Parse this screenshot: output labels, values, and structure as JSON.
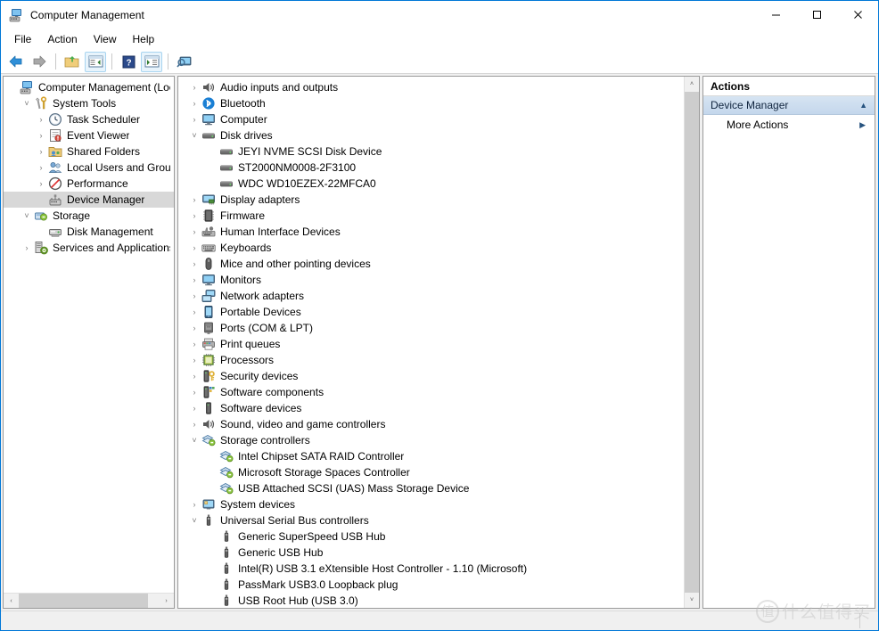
{
  "window": {
    "title": "Computer Management",
    "icon": "computer-management-icon",
    "minimize": "—",
    "maximize": "☐",
    "close": "✕"
  },
  "menu": [
    {
      "label": "File"
    },
    {
      "label": "Action"
    },
    {
      "label": "View"
    },
    {
      "label": "Help"
    }
  ],
  "toolbar": [
    {
      "name": "back-button",
      "icon": "back-arrow-icon",
      "framed": false
    },
    {
      "name": "forward-button",
      "icon": "forward-arrow-icon",
      "framed": false
    },
    {
      "name": "separator-1",
      "icon": "separator",
      "framed": false
    },
    {
      "name": "up-folder-button",
      "icon": "folder-up-icon",
      "framed": false
    },
    {
      "name": "show-hide-console-tree-button",
      "icon": "console-tree-icon",
      "framed": true
    },
    {
      "name": "separator-2",
      "icon": "separator",
      "framed": false
    },
    {
      "name": "help-button",
      "icon": "question-mark-icon",
      "framed": false
    },
    {
      "name": "show-hide-action-pane-button",
      "icon": "action-pane-icon",
      "framed": true
    },
    {
      "name": "separator-3",
      "icon": "separator",
      "framed": false
    },
    {
      "name": "scan-hardware-changes-button",
      "icon": "monitor-scan-icon",
      "framed": false
    }
  ],
  "console_tree": {
    "items": [
      {
        "label": "Computer Management (Local",
        "indent": 0,
        "state": "none",
        "icon": "computer-management-icon",
        "selected": false
      },
      {
        "label": "System Tools",
        "indent": 1,
        "state": "expanded",
        "icon": "system-tools-icon",
        "selected": false
      },
      {
        "label": "Task Scheduler",
        "indent": 2,
        "state": "collapsed",
        "icon": "clock-icon",
        "selected": false
      },
      {
        "label": "Event Viewer",
        "indent": 2,
        "state": "collapsed",
        "icon": "event-viewer-icon",
        "selected": false
      },
      {
        "label": "Shared Folders",
        "indent": 2,
        "state": "collapsed",
        "icon": "shared-folders-icon",
        "selected": false
      },
      {
        "label": "Local Users and Groups",
        "indent": 2,
        "state": "collapsed",
        "icon": "users-icon",
        "selected": false
      },
      {
        "label": "Performance",
        "indent": 2,
        "state": "collapsed",
        "icon": "performance-icon",
        "selected": false
      },
      {
        "label": "Device Manager",
        "indent": 2,
        "state": "none",
        "icon": "device-manager-icon",
        "selected": true
      },
      {
        "label": "Storage",
        "indent": 1,
        "state": "expanded",
        "icon": "storage-icon",
        "selected": false
      },
      {
        "label": "Disk Management",
        "indent": 2,
        "state": "none",
        "icon": "disk-management-icon",
        "selected": false
      },
      {
        "label": "Services and Applications",
        "indent": 1,
        "state": "collapsed",
        "icon": "services-icon",
        "selected": false
      }
    ],
    "hscroll": {
      "left_arrow": "‹",
      "right_arrow": "›"
    }
  },
  "device_tree": {
    "items": [
      {
        "label": "Audio inputs and outputs",
        "indent": 0,
        "state": "collapsed",
        "icon": "speaker-icon"
      },
      {
        "label": "Bluetooth",
        "indent": 0,
        "state": "collapsed",
        "icon": "bluetooth-icon"
      },
      {
        "label": "Computer",
        "indent": 0,
        "state": "collapsed",
        "icon": "monitor-icon"
      },
      {
        "label": "Disk drives",
        "indent": 0,
        "state": "expanded",
        "icon": "disk-drive-icon"
      },
      {
        "label": "JEYI NVME SCSI Disk Device",
        "indent": 1,
        "state": "none",
        "icon": "disk-drive-icon"
      },
      {
        "label": "ST2000NM0008-2F3100",
        "indent": 1,
        "state": "none",
        "icon": "disk-drive-icon"
      },
      {
        "label": "WDC WD10EZEX-22MFCA0",
        "indent": 1,
        "state": "none",
        "icon": "disk-drive-icon"
      },
      {
        "label": "Display adapters",
        "indent": 0,
        "state": "collapsed",
        "icon": "display-adapter-icon"
      },
      {
        "label": "Firmware",
        "indent": 0,
        "state": "collapsed",
        "icon": "firmware-chip-icon"
      },
      {
        "label": "Human Interface Devices",
        "indent": 0,
        "state": "collapsed",
        "icon": "hid-icon"
      },
      {
        "label": "Keyboards",
        "indent": 0,
        "state": "collapsed",
        "icon": "keyboard-icon"
      },
      {
        "label": "Mice and other pointing devices",
        "indent": 0,
        "state": "collapsed",
        "icon": "mouse-icon"
      },
      {
        "label": "Monitors",
        "indent": 0,
        "state": "collapsed",
        "icon": "monitor-icon"
      },
      {
        "label": "Network adapters",
        "indent": 0,
        "state": "collapsed",
        "icon": "network-adapter-icon"
      },
      {
        "label": "Portable Devices",
        "indent": 0,
        "state": "collapsed",
        "icon": "portable-device-icon"
      },
      {
        "label": "Ports (COM & LPT)",
        "indent": 0,
        "state": "collapsed",
        "icon": "port-icon"
      },
      {
        "label": "Print queues",
        "indent": 0,
        "state": "collapsed",
        "icon": "printer-icon"
      },
      {
        "label": "Processors",
        "indent": 0,
        "state": "collapsed",
        "icon": "processor-icon"
      },
      {
        "label": "Security devices",
        "indent": 0,
        "state": "collapsed",
        "icon": "security-device-icon"
      },
      {
        "label": "Software components",
        "indent": 0,
        "state": "collapsed",
        "icon": "software-component-icon"
      },
      {
        "label": "Software devices",
        "indent": 0,
        "state": "collapsed",
        "icon": "software-device-icon"
      },
      {
        "label": "Sound, video and game controllers",
        "indent": 0,
        "state": "collapsed",
        "icon": "speaker-icon"
      },
      {
        "label": "Storage controllers",
        "indent": 0,
        "state": "expanded",
        "icon": "storage-controller-icon"
      },
      {
        "label": "Intel Chipset SATA RAID Controller",
        "indent": 1,
        "state": "none",
        "icon": "storage-controller-icon"
      },
      {
        "label": "Microsoft Storage Spaces Controller",
        "indent": 1,
        "state": "none",
        "icon": "storage-controller-icon"
      },
      {
        "label": "USB Attached SCSI (UAS) Mass Storage Device",
        "indent": 1,
        "state": "none",
        "icon": "storage-controller-icon"
      },
      {
        "label": "System devices",
        "indent": 0,
        "state": "collapsed",
        "icon": "system-device-icon"
      },
      {
        "label": "Universal Serial Bus controllers",
        "indent": 0,
        "state": "expanded",
        "icon": "usb-icon"
      },
      {
        "label": "Generic SuperSpeed USB Hub",
        "indent": 1,
        "state": "none",
        "icon": "usb-icon"
      },
      {
        "label": "Generic USB Hub",
        "indent": 1,
        "state": "none",
        "icon": "usb-icon"
      },
      {
        "label": "Intel(R) USB 3.1 eXtensible Host Controller - 1.10 (Microsoft)",
        "indent": 1,
        "state": "none",
        "icon": "usb-icon"
      },
      {
        "label": "PassMark USB3.0 Loopback plug",
        "indent": 1,
        "state": "none",
        "icon": "usb-icon"
      },
      {
        "label": "USB Root Hub (USB 3.0)",
        "indent": 1,
        "state": "none",
        "icon": "usb-icon"
      }
    ],
    "vscroll": {
      "up_arrow": "˄",
      "down_arrow": "˅"
    }
  },
  "actions": {
    "header": "Actions",
    "section_title": "Device Manager",
    "section_collapse_arrow": "▲",
    "items": [
      {
        "label": "More Actions",
        "submenu_arrow": "▶"
      }
    ]
  },
  "watermark": {
    "logo_char": "值",
    "text": "什么值得买"
  },
  "colors": {
    "window_border": "#0078d7",
    "selection": "#d8d8d8",
    "actions_band": "#c9dcef",
    "scrollbar_thumb": "#cdcdcd"
  }
}
